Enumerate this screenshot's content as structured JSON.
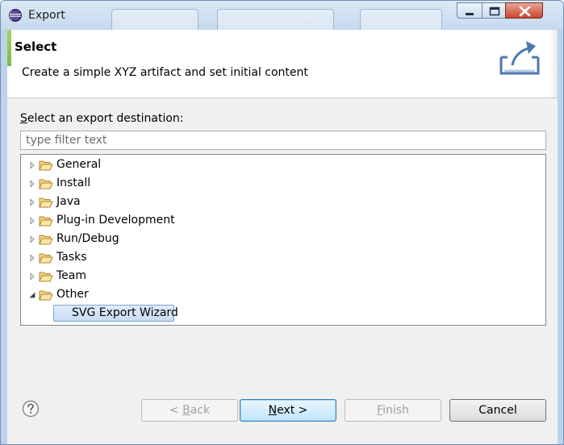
{
  "window": {
    "title": "Export"
  },
  "header": {
    "title": "Select",
    "description": "Create a simple XYZ artifact and set initial content"
  },
  "destination": {
    "label_mnemonic": "S",
    "label_rest": "elect an export destination:",
    "filter_placeholder": "type filter text",
    "filter_value": ""
  },
  "tree": {
    "items": [
      {
        "label": "General",
        "expanded": false
      },
      {
        "label": "Install",
        "expanded": false
      },
      {
        "label": "Java",
        "expanded": false
      },
      {
        "label": "Plug-in Development",
        "expanded": false
      },
      {
        "label": "Run/Debug",
        "expanded": false
      },
      {
        "label": "Tasks",
        "expanded": false
      },
      {
        "label": "Team",
        "expanded": false
      },
      {
        "label": "Other",
        "expanded": true
      }
    ],
    "selected_child": {
      "label": "SVG Export Wizard"
    }
  },
  "buttons": {
    "back_prefix": "< ",
    "back_mnemonic": "B",
    "back_rest": "ack",
    "next_mnemonic": "N",
    "next_rest": "ext >",
    "finish_mnemonic": "F",
    "finish_rest": "inish",
    "cancel": "Cancel"
  },
  "icons": {
    "app": "eclipse-icon",
    "help": "help-icon",
    "banner": "export-wizard-banner-icon",
    "folder": "folder-icon"
  },
  "colors": {
    "accent_green": "#79b94a",
    "selection": "#c8dcf4",
    "default_button_border": "#3c7fb1"
  }
}
